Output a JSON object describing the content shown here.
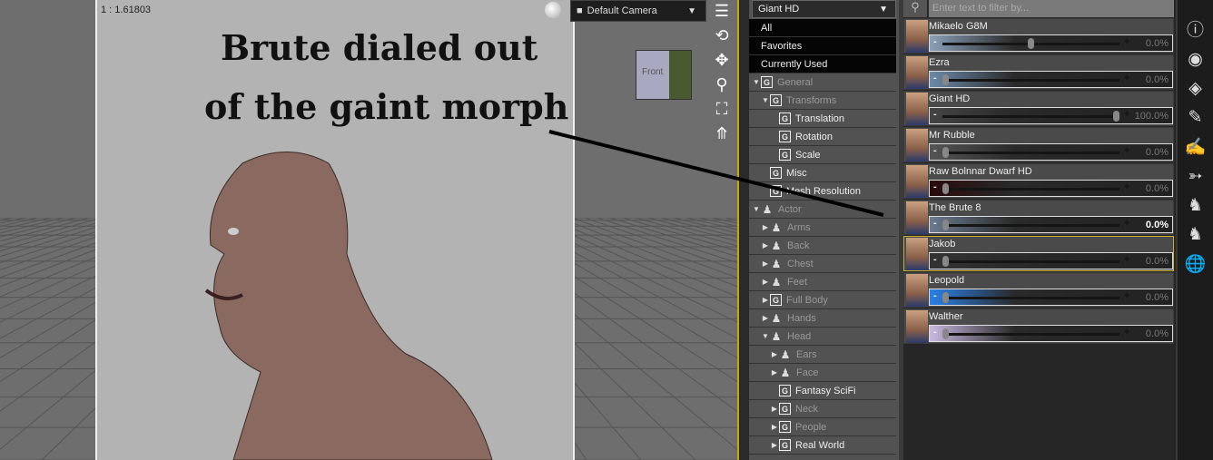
{
  "viewport": {
    "ratio": "1 : 1.61803",
    "annotation_line1": "Brute dialed out",
    "annotation_line2": "of the gaint morph",
    "camera": "Default Camera",
    "cube_label": "Front"
  },
  "nav_icons": [
    "viewport-menu-icon",
    "orbit-icon",
    "pan-icon",
    "zoom-icon",
    "frame-icon",
    "reset-view-icon"
  ],
  "tree": {
    "preset": "Giant HD",
    "top_items": [
      "All",
      "Favorites",
      "Currently Used"
    ],
    "items": [
      {
        "label": "General",
        "icon": "G",
        "indent": 0,
        "twisty": "down",
        "active": false
      },
      {
        "label": "Transforms",
        "icon": "G",
        "indent": 1,
        "twisty": "down",
        "active": false
      },
      {
        "label": "Translation",
        "icon": "G",
        "indent": 2,
        "twisty": "",
        "active": true
      },
      {
        "label": "Rotation",
        "icon": "G",
        "indent": 2,
        "twisty": "",
        "active": true
      },
      {
        "label": "Scale",
        "icon": "G",
        "indent": 2,
        "twisty": "",
        "active": true
      },
      {
        "label": "Misc",
        "icon": "G",
        "indent": 1,
        "twisty": "",
        "active": true
      },
      {
        "label": "Mesh Resolution",
        "icon": "G",
        "indent": 1,
        "twisty": "",
        "active": true
      },
      {
        "label": "Actor",
        "icon": "P",
        "indent": 0,
        "twisty": "down",
        "active": false
      },
      {
        "label": "Arms",
        "icon": "P",
        "indent": 1,
        "twisty": "right",
        "active": false
      },
      {
        "label": "Back",
        "icon": "P",
        "indent": 1,
        "twisty": "right",
        "active": false
      },
      {
        "label": "Chest",
        "icon": "P",
        "indent": 1,
        "twisty": "right",
        "active": false
      },
      {
        "label": "Feet",
        "icon": "P",
        "indent": 1,
        "twisty": "right",
        "active": false
      },
      {
        "label": "Full Body",
        "icon": "G",
        "indent": 1,
        "twisty": "right",
        "active": false
      },
      {
        "label": "Hands",
        "icon": "P",
        "indent": 1,
        "twisty": "right",
        "active": false
      },
      {
        "label": "Head",
        "icon": "P",
        "indent": 1,
        "twisty": "down",
        "active": false
      },
      {
        "label": "Ears",
        "icon": "P",
        "indent": 2,
        "twisty": "right",
        "active": false
      },
      {
        "label": "Face",
        "icon": "P",
        "indent": 2,
        "twisty": "right",
        "active": false
      },
      {
        "label": "Fantasy SciFi",
        "icon": "G",
        "indent": 2,
        "twisty": "",
        "active": true
      },
      {
        "label": "Neck",
        "icon": "G",
        "indent": 2,
        "twisty": "right",
        "active": false
      },
      {
        "label": "People",
        "icon": "G",
        "indent": 2,
        "twisty": "right",
        "active": false
      },
      {
        "label": "Real World",
        "icon": "G",
        "indent": 2,
        "twisty": "right",
        "active": true
      }
    ]
  },
  "morphs": {
    "filter_placeholder": "Enter text to filter by...",
    "items": [
      {
        "name": "Mikaelo G8M",
        "value": "0.0%",
        "fraction": 0.5,
        "color": "#8aa0b8",
        "selected": false,
        "bright": false
      },
      {
        "name": "Ezra",
        "value": "0.0%",
        "fraction": 0,
        "color": "#6a8aa8",
        "selected": false,
        "bright": false
      },
      {
        "name": "Giant HD",
        "value": "100.0%",
        "fraction": 1,
        "color": "#444",
        "selected": false,
        "bright": false
      },
      {
        "name": "Mr Rubble",
        "value": "0.0%",
        "fraction": 0,
        "color": "#555",
        "selected": false,
        "bright": false
      },
      {
        "name": "Raw Bolnnar Dwarf HD",
        "value": "0.0%",
        "fraction": 0,
        "color": "#2a0a0a",
        "selected": false,
        "bright": false
      },
      {
        "name": "The Brute 8",
        "value": "0.0%",
        "fraction": 0,
        "color": "#6a7a90",
        "selected": false,
        "bright": true
      },
      {
        "name": "Jakob",
        "value": "0.0%",
        "fraction": 0,
        "color": "#333",
        "selected": true,
        "bright": false
      },
      {
        "name": "Leopold",
        "value": "0.0%",
        "fraction": 0,
        "color": "#2a80e8",
        "selected": false,
        "bright": false
      },
      {
        "name": "Walther",
        "value": "0.0%",
        "fraction": 0,
        "color": "#c8b8e0",
        "selected": false,
        "bright": false
      }
    ]
  },
  "right_bar_icons": [
    "info-icon",
    "surface-shader-icon",
    "scene-tree-icon",
    "script-edit-icon",
    "figure-edit-icon",
    "pose-transfer-icon",
    "morph-icon",
    "pose-morph-icon",
    "globe-edit-icon"
  ]
}
